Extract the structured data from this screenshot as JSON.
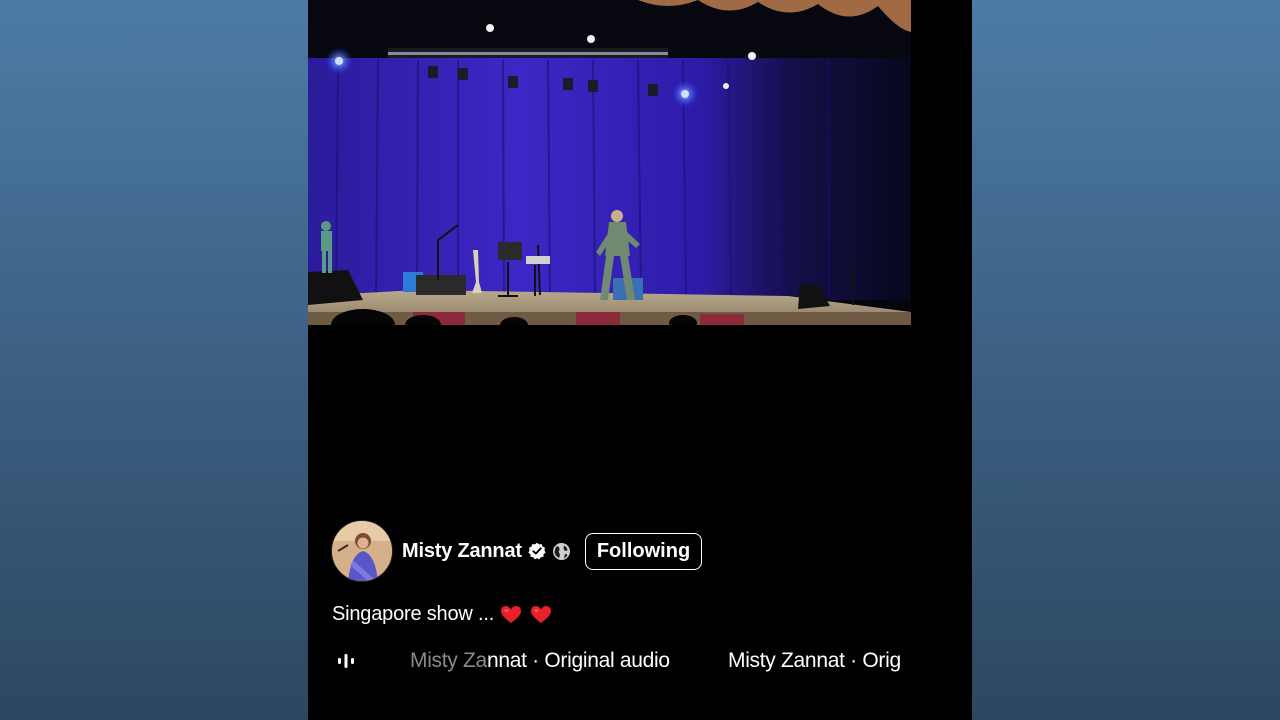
{
  "post": {
    "author": {
      "name": "Misty Zannat",
      "verified_icon": "verified-check-icon",
      "audience_icon": "globe-icon",
      "follow_label": "Following"
    },
    "caption": {
      "text": "Singapore show ...",
      "emoji": [
        "heart",
        "heart"
      ],
      "emoji_color": "#e8202a"
    },
    "audio": {
      "icon": "audio-bars-icon",
      "faded_prefix": "Misty Za",
      "faded_rest": "nnat · Original audio",
      "repeat_visible": "Misty Zannat · Orig"
    }
  },
  "colors": {
    "frame_bg": "#000000",
    "page_gradient_top": "#4d7ba6",
    "page_gradient_bottom": "#2c4761",
    "stage_curtain": "#3a22b8"
  }
}
